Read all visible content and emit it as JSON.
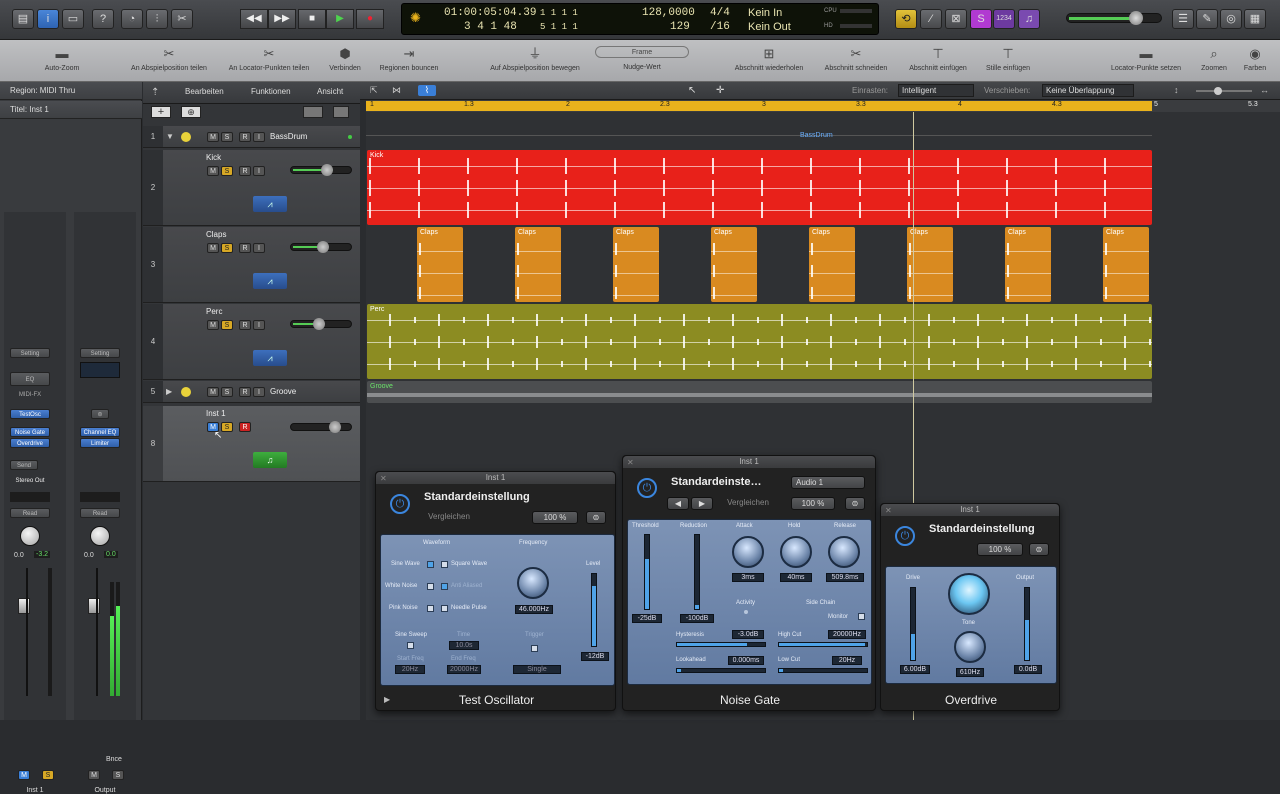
{
  "control_bar": {
    "transport": {
      "rewind": "◀◀",
      "forward": "▶▶",
      "stop": "■",
      "play": "▶",
      "record": "●"
    },
    "lcd": {
      "time": "01:00:05:04.39",
      "bars": "3  4  1    48",
      "pos_a": "1   1   1     1",
      "pos_b": "5   1   1     1",
      "tempo": "128,0000",
      "tempo2": "129",
      "sig": "4/4",
      "div": "/16",
      "in": "Kein In",
      "out": "Kein Out",
      "cpu": "CPU",
      "hd": "HD"
    },
    "badge": "1234"
  },
  "toolbar": {
    "items": [
      {
        "label": "Auto-Zoom",
        "icon": "auto-zoom-icon"
      },
      {
        "label": "An Abspielposition teilen",
        "icon": "scissors-icon"
      },
      {
        "label": "An Locator-Punkten teilen",
        "icon": "scissors-icon"
      },
      {
        "label": "Verbinden",
        "icon": "glue-icon"
      },
      {
        "label": "Regionen bouncen",
        "icon": "bounce-icon"
      },
      {
        "label": "Auf Abspielposition bewegen",
        "icon": "move-icon"
      },
      {
        "label": "Nudge-Wert",
        "icon": "nudge-icon"
      },
      {
        "label": "Abschnitt wiederholen",
        "icon": "repeat-section-icon"
      },
      {
        "label": "Abschnitt schneiden",
        "icon": "cut-section-icon"
      },
      {
        "label": "Abschnitt einfügen",
        "icon": "insert-section-icon"
      },
      {
        "label": "Stille einfügen",
        "icon": "silence-icon"
      },
      {
        "label": "Locator-Punkte setzen",
        "icon": "locator-icon"
      },
      {
        "label": "Zoomen",
        "icon": "zoom-icon"
      },
      {
        "label": "Farben",
        "icon": "palette-icon"
      }
    ],
    "nudge_value": "Frame"
  },
  "inspector": {
    "region": "Region:  MIDI Thru",
    "title": "Titel:  Inst 1",
    "strip1": {
      "setting": "Setting",
      "eq": "EQ",
      "midifx": "MIDI-FX",
      "inst": "TestOsc",
      "fx1": "Noise Gate",
      "fx2": "Overdrive",
      "send": "Send",
      "output": "Stereo Out",
      "auto": "Read",
      "pan_val": "0.0",
      "gain": "-3.2",
      "m": "M",
      "s": "S",
      "name": "Inst 1"
    },
    "strip2": {
      "setting": "Setting",
      "fx1": "Channel EQ",
      "fx2": "Limiter",
      "auto": "Read",
      "pan_val": "0.0",
      "gain": "0.0",
      "m": "M",
      "s": "S",
      "bnce": "Bnce",
      "name": "Output"
    }
  },
  "track_header": {
    "menus": [
      "Bearbeiten",
      "Funktionen",
      "Ansicht"
    ]
  },
  "tracks": [
    {
      "num": "1",
      "name": "BassDrum"
    },
    {
      "num": "2",
      "name": "Kick"
    },
    {
      "num": "3",
      "name": "Claps"
    },
    {
      "num": "4",
      "name": "Perc"
    },
    {
      "num": "5",
      "name": "Groove"
    },
    {
      "num": "8",
      "name": "Inst 1"
    }
  ],
  "buttons": {
    "m": "M",
    "s": "S",
    "r": "R",
    "i": "I"
  },
  "arrange_header": {
    "snap_label": "Einrasten:",
    "snap_value": "Intelligent",
    "drag_label": "Verschieben:",
    "drag_value": "Keine Überlappung"
  },
  "ruler": [
    "1",
    "1.3",
    "2",
    "2.3",
    "3",
    "3.3",
    "4",
    "4.3",
    "5",
    "5.3"
  ],
  "regions": {
    "folder": "BassDrum",
    "kick": "Kick",
    "claps": "Claps",
    "perc": "Perc",
    "groove": "Groove"
  },
  "test_osc": {
    "title": "Inst 1",
    "preset": "Standardeinstellung",
    "compare": "Vergleichen",
    "zoom": "100 %",
    "waveform": "Waveform",
    "sine": "Sine Wave",
    "square": "Square Wave",
    "white": "White Noise",
    "anti": "Anti Aliased",
    "pink": "Pink Noise",
    "needle": "Needle Pulse",
    "frequency": "Frequency",
    "freq_val": "46.000Hz",
    "level": "Level",
    "level_val": "-12dB",
    "sweep": "Sine Sweep",
    "time": "Time",
    "time_val": "10.0s",
    "trigger": "Trigger",
    "start": "Start Freq",
    "start_val": "20Hz",
    "end": "End Freq",
    "end_val": "20000Hz",
    "single": "Single",
    "name": "Test Oscillator"
  },
  "noise_gate": {
    "title": "Inst 1",
    "preset": "Standardeinste…",
    "sidechain_input": "Audio 1",
    "compare": "Vergleichen",
    "zoom": "100 %",
    "threshold": "Threshold",
    "threshold_val": "-25dB",
    "reduction": "Reduction",
    "reduction_val": "-100dB",
    "attack": "Attack",
    "attack_val": "3ms",
    "hold": "Hold",
    "hold_val": "40ms",
    "release": "Release",
    "release_val": "509.8ms",
    "activity": "Activity",
    "side_chain": "Side Chain",
    "monitor": "Monitor",
    "hysteresis": "Hysteresis",
    "hysteresis_val": "-3.0dB",
    "highcut": "High Cut",
    "highcut_val": "20000Hz",
    "lookahead": "Lookahead",
    "lookahead_val": "0.000ms",
    "lowcut": "Low Cut",
    "lowcut_val": "20Hz",
    "name": "Noise Gate"
  },
  "overdrive": {
    "title": "Inst 1",
    "preset": "Standardeinstellung",
    "zoom": "100 %",
    "drive": "Drive",
    "drive_val": "6.00dB",
    "tone": "Tone",
    "tone_val": "610Hz",
    "output": "Output",
    "output_val": "0.0dB",
    "name": "Overdrive"
  },
  "colors": {
    "kick": "#e8211a",
    "claps": "#d98a20",
    "perc": "#8c8c22",
    "cycle": "#e9b21c",
    "accent": "#3b86de"
  }
}
